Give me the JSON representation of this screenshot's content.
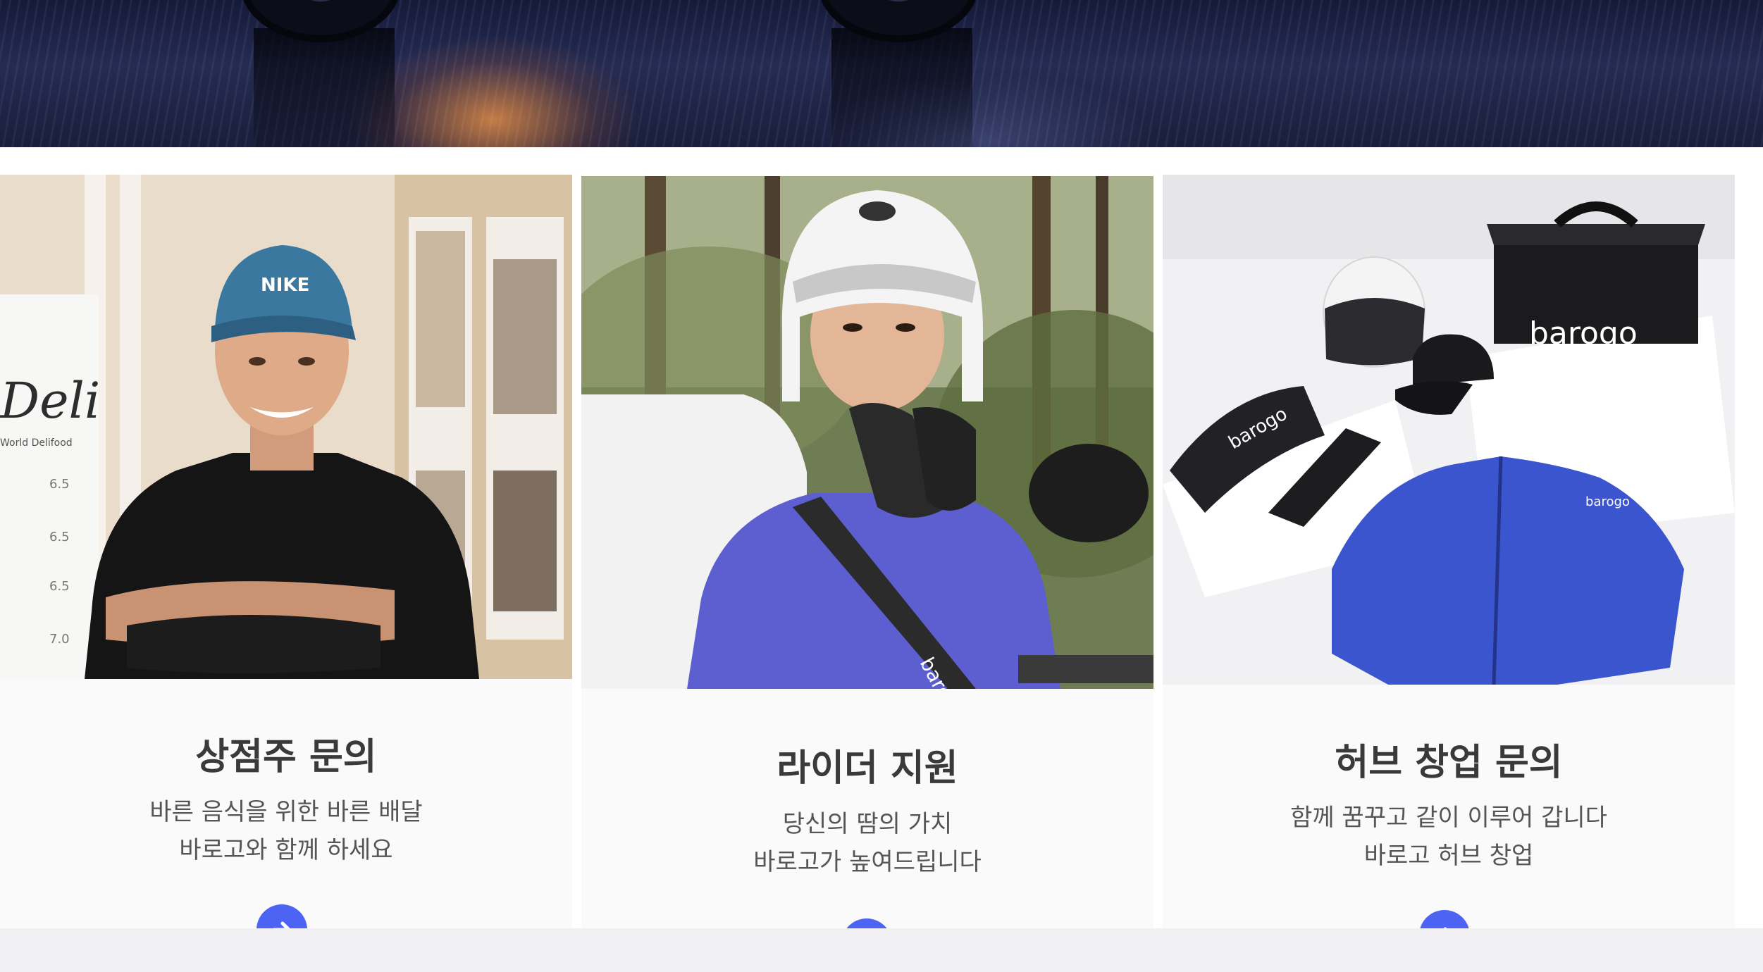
{
  "colors": {
    "accent": "#4c63f3",
    "title_text": "#3a3a3c",
    "body_text": "#555558",
    "card_bg": "#fafafb"
  },
  "cards": [
    {
      "title": "상점주 문의",
      "desc_line1": "바른 음식을 위한 바른 배달",
      "desc_line2": "바로고와 함께 하세요",
      "sign_text": "Deli",
      "sign_sub": "World Delifood",
      "cap_logo": "NIKE",
      "button_icon": "arrow-right-icon"
    },
    {
      "title": "라이더 지원",
      "desc_line1": "당신의 땀의 가치",
      "desc_line2": "바로고가 높여드립니다",
      "strap_logo": "barogo",
      "button_icon": "arrow-right-icon"
    },
    {
      "title": "허브 창업 문의",
      "desc_line1": "함께 꿈꾸고 같이 이루어 갑니다",
      "desc_line2": "바로고 허브 창업",
      "bag_logo": "barogo",
      "pouch_logo": "barogo",
      "jacket_logo": "barogo",
      "button_icon": "arrow-right-icon"
    }
  ]
}
